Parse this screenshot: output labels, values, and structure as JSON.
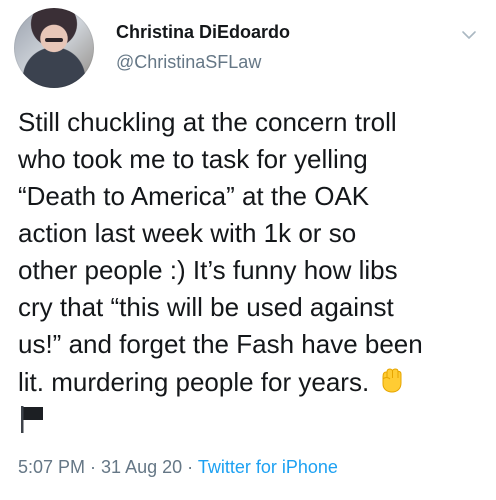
{
  "user": {
    "display_name": "Christina DiEdoardo",
    "handle": "@ChristinaSFLaw"
  },
  "tweet": {
    "lines": [
      "Still chuckling at the concern troll",
      "who took me to task for yelling",
      "“Death to America” at the OAK",
      "action last week with 1k or so",
      "other people :) It’s funny how libs",
      "cry that “this will be used against",
      "us!” and forget the Fash have been",
      "lit. murdering people for years."
    ],
    "emoji_1": "raised-fist-emoji",
    "emoji_2": "black-flag-emoji"
  },
  "meta": {
    "time": "5:07 PM",
    "sep1": " · ",
    "date": "31 Aug 20",
    "sep2": " · ",
    "source": "Twitter for iPhone"
  },
  "icons": {
    "chevron": "chevron-down-icon"
  },
  "colors": {
    "text": "#14171a",
    "secondary": "#657786",
    "link": "#1da1f2",
    "fist": "#ffcc33"
  }
}
